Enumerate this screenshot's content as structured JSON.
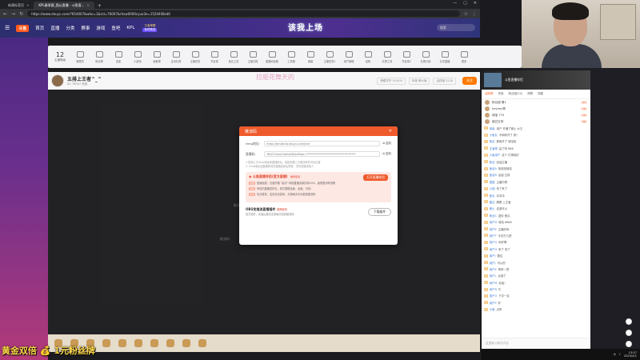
{
  "browser": {
    "tabs": [
      {
        "label": "新建标签页",
        "active": false
      },
      {
        "label": "KPL春季赛_我从直播 - 斗鱼直...",
        "active": true
      }
    ],
    "url": "https://www.douyu.com/?654007&who=1&rid=76007&rhxw0000cyuo3e=1520408sd6"
  },
  "site": {
    "logo": "斗鱼",
    "nav": [
      "首页",
      "直播",
      "分类",
      "赛事",
      "游戏",
      "鱼吧",
      "KPL"
    ],
    "kpl_badge": {
      "top": "王者荣耀",
      "bottom": "鱼吧精选"
    },
    "banner_text": "该我上场",
    "search_placeholder": "搜索"
  },
  "toolbar": {
    "level": "12",
    "level_label": "主播等级",
    "tools": [
      "管理员",
      "粉丝榜",
      "连麦",
      "小游戏",
      "贡献榜",
      "互动礼物",
      "主播任务",
      "节目单",
      "鱼丸工具",
      "主播日程",
      "直播间设置",
      "工具箱",
      "弹幕",
      "主播任务2",
      "用户管理",
      "钻粉",
      "礼物工具",
      "节目单2",
      "礼物计划",
      "分享直播",
      "更多"
    ]
  },
  "streamer": {
    "title": "五排上王者^_^",
    "meta": "ID: 76007  贵族",
    "banner_art": "拉船花舞天的",
    "stats": [
      "荣耀守护 5/1000",
      "年度 拳头版",
      "活跃值 2228"
    ],
    "follow_label": "关注"
  },
  "video": {
    "ghost_left": "推流",
    "ghost_center": "推流码"
  },
  "modal": {
    "title": "推流码",
    "rtmp_label": "rtmp地址:",
    "rtmp_value": "rtmp://sendtc3a.douyu.com/live",
    "key_label": "直播码:",
    "key_value": "76007rXzq7a6GaSN3ptMqU=************************************",
    "copy_label": "复制",
    "notes": [
      "1.复制上方rtmp地址和直播码后，粘贴到第三方推流软件对应位置",
      "2. rtmp地址及直播码将在直播结束后重置，请勿泄露给他人"
    ],
    "promo_title": "斗鱼直播伴侣(官方直播)",
    "promo_tag": "推荐使用",
    "open_label": "打开直播伴侣",
    "promo_lines": [
      {
        "badge": "功能",
        "text": "极致画质，光速开播 \"高清\" 特权直播流量扶持20%，画质更清晰流畅"
      },
      {
        "badge": "活动",
        "text": "伴侣内直播送好礼，官方数据全面、全面、可靠!"
      },
      {
        "badge": "玩法",
        "text": "玩法更多，支持互动游戏、无需每天手动复制推流码"
      }
    ],
    "obs_title": "OBS免推流直播插件",
    "obs_tag": "推荐使用",
    "obs_desc": "官方插件，安装后推流无需每次复制推流码",
    "download_label": "下载插件"
  },
  "overlay_text": "黄金双倍 💰 1元粉丝牌",
  "panel": {
    "banner": "斗鱼直播伴侣",
    "tabs": [
      "活跃榜",
      "贵族",
      "粉丝团(25)",
      "周榜",
      "周星"
    ],
    "ranks": [
      {
        "name": "粉丝团 第1",
        "badge": "27"
      },
      {
        "name": "heyhey哥",
        "badge": "18"
      },
      {
        "name": "绿宝 770",
        "badge": "10"
      },
      {
        "name": "超过五排",
        "badge": "26"
      }
    ],
    "messages": [
      {
        "name": "恭喜",
        "text": "用户 开通了骑士 大王"
      },
      {
        "name": "小鱼丸",
        "text": "不和你开了 我！"
      },
      {
        "name": "鱼友",
        "text": "那我开了 哈哈哈"
      },
      {
        "name": "王者哥",
        "text": "赢了吗 666"
      },
      {
        "name": "斗鱼用户",
        "text": "这个 打得真好"
      },
      {
        "name": "粉丝",
        "text": "加油主播"
      },
      {
        "name": "鱼友A",
        "text": "哈哈哈哈哈"
      },
      {
        "name": "鱼友B",
        "text": "走起 五排"
      },
      {
        "name": "猫猫",
        "text": "主播牛啊"
      },
      {
        "name": "小团",
        "text": "来了来了"
      },
      {
        "name": "鱼丸",
        "text": "冲冲冲"
      },
      {
        "name": "路过",
        "text": "看看 上王者"
      },
      {
        "name": "骑士",
        "text": "这波可以"
      },
      {
        "name": "粉丝C",
        "text": "送你 鱼丸"
      },
      {
        "name": "用户D",
        "text": "哈哈 6666"
      },
      {
        "name": "用户E",
        "text": "主播好帅"
      },
      {
        "name": "用户F",
        "text": "今天打几把"
      },
      {
        "name": "用户G",
        "text": "你好啊"
      },
      {
        "name": "用户H",
        "text": "来了 来了"
      },
      {
        "name": "用户I",
        "text": "稳住"
      },
      {
        "name": "用户J",
        "text": "可以的"
      },
      {
        "name": "用户K",
        "text": "再来一把"
      },
      {
        "name": "用户L",
        "text": "太强了"
      },
      {
        "name": "用户M",
        "text": "加油！"
      },
      {
        "name": "用户N",
        "text": "牛"
      },
      {
        "name": "用户O",
        "text": "下次一定"
      },
      {
        "name": "用户P",
        "text": "好"
      },
      {
        "name": "小鱼",
        "text": "点赞"
      }
    ],
    "input_placeholder": "这里输入聊天内容"
  },
  "taskbar": {
    "time": "13:57",
    "date": "2025/4/1"
  }
}
